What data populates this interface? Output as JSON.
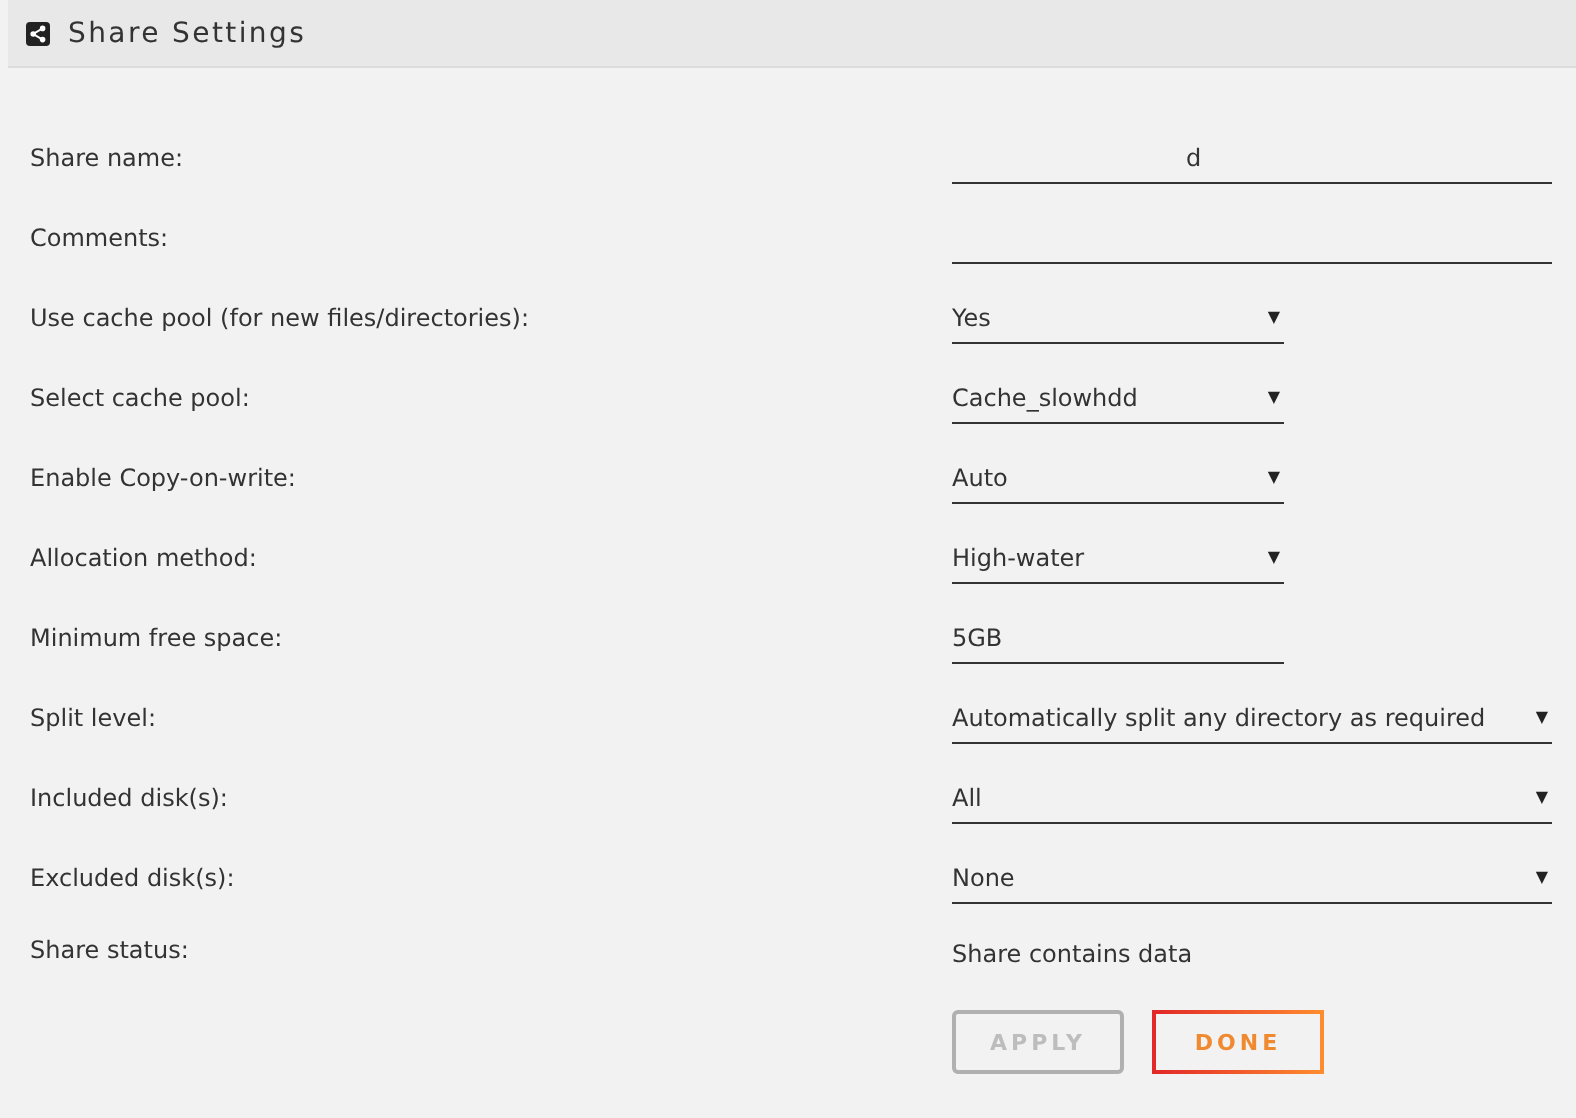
{
  "header": {
    "title": "Share Settings"
  },
  "settings": [
    {
      "label": "Share name:",
      "kind": "wideinput",
      "value": "d",
      "redacted": true
    },
    {
      "label": "Comments:",
      "kind": "wideinput"
    },
    {
      "label": "Use cache pool (for new files/directories):",
      "kind": "dropdown",
      "value": "Yes",
      "caret": "▼"
    },
    {
      "label": "Select cache pool:",
      "kind": "dropdown",
      "value": "Cache_slowhdd",
      "caret": "▼"
    },
    {
      "label": "Enable Copy-on-write:",
      "kind": "dropdown",
      "value": "Auto",
      "caret": "▼"
    },
    {
      "label": "Allocation method:",
      "kind": "dropdown",
      "value": "High-water",
      "caret": "▼"
    },
    {
      "label": "Minimum free space:",
      "kind": "input",
      "value": "5GB"
    },
    {
      "label": "Split level:",
      "kind": "widedropdown",
      "value": "Automatically split any directory as required",
      "caret": "▼"
    },
    {
      "label": "Included disk(s):",
      "kind": "widedropdown",
      "value": "All",
      "caret": "▼"
    },
    {
      "label": "Excluded disk(s):",
      "kind": "widedropdown",
      "value": "None",
      "caret": "▼"
    },
    {
      "label": "Share status:",
      "kind": "static",
      "value": "Share contains data"
    }
  ],
  "buttons": [
    {
      "label": "APPLY",
      "disabled": true
    },
    {
      "label": "DONE",
      "disabled": false
    }
  ]
}
